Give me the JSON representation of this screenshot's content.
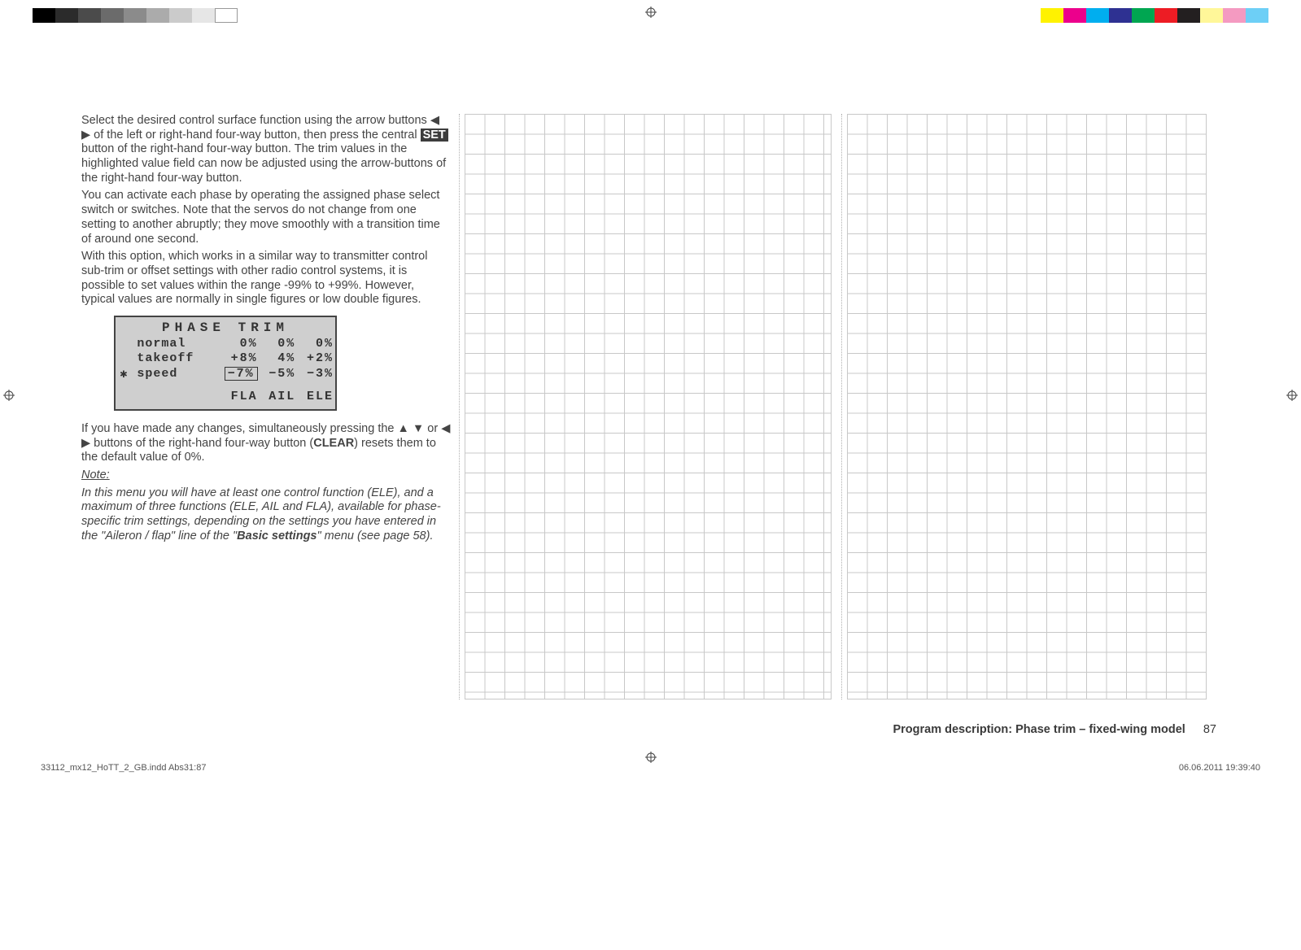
{
  "body": {
    "p1_a": "Select the desired control surface function using the arrow buttons ",
    "p1_b": " of the left or right-hand four-way button, then press the central ",
    "p1_set": "SET",
    "p1_c": " button of the right-hand four-way button. The trim values in the highlighted value field can now be adjusted using the arrow-buttons of the right-hand four-way button.",
    "p2": "You can activate each phase by operating the assigned phase select switch or switches. Note that the servos do not change from one setting to another abruptly; they move smoothly with a transition time of around one second.",
    "p3": "With this option, which works in a similar way to transmitter control sub-trim or offset settings with other radio control systems, it is possible to set values within the range -99% to +99%. However, typical values are normally in single figures or low double figures.",
    "p4_a": "If you have made any changes, simultaneously pressing the ",
    "p4_b": " or ",
    "p4_c": " buttons of the right-hand four-way button (",
    "p4_clear": "CLEAR",
    "p4_d": ") resets them to the default value of 0%.",
    "note_label": "Note:",
    "note_body_a": "In this menu you will have at least one control function (ELE), and a maximum of three functions (ELE, AIL and FLA), available for phase-specific trim settings, depending on the settings you have entered in the \"Aileron / flap\" line of the \"",
    "note_body_bold": "Basic settings",
    "note_body_b": "\" menu (see page 58)."
  },
  "lcd": {
    "title": "PHASE  TRIM",
    "rows": [
      {
        "name": "normal",
        "fla": "0%",
        "ail": "0%",
        "ele": "0%",
        "marker": "",
        "sel": false
      },
      {
        "name": "takeoff",
        "fla": "+8%",
        "ail": "4%",
        "ele": "+2%",
        "marker": "",
        "sel": false
      },
      {
        "name": "speed",
        "fla": "−7%",
        "ail": "−5%",
        "ele": "−3%",
        "marker": "✱",
        "sel": true
      }
    ],
    "cols": {
      "fla": "FLA",
      "ail": "AIL",
      "ele": "ELE"
    }
  },
  "footer": {
    "label": "Program description: Phase trim – fixed-wing model",
    "page": "87"
  },
  "slug": {
    "file": "33112_mx12_HoTT_2_GB.indd   Abs31:87",
    "stamp": "06.06.2011   19:39:40"
  },
  "arrows": {
    "lr": "◀ ▶",
    "ud": "▲ ▼"
  }
}
